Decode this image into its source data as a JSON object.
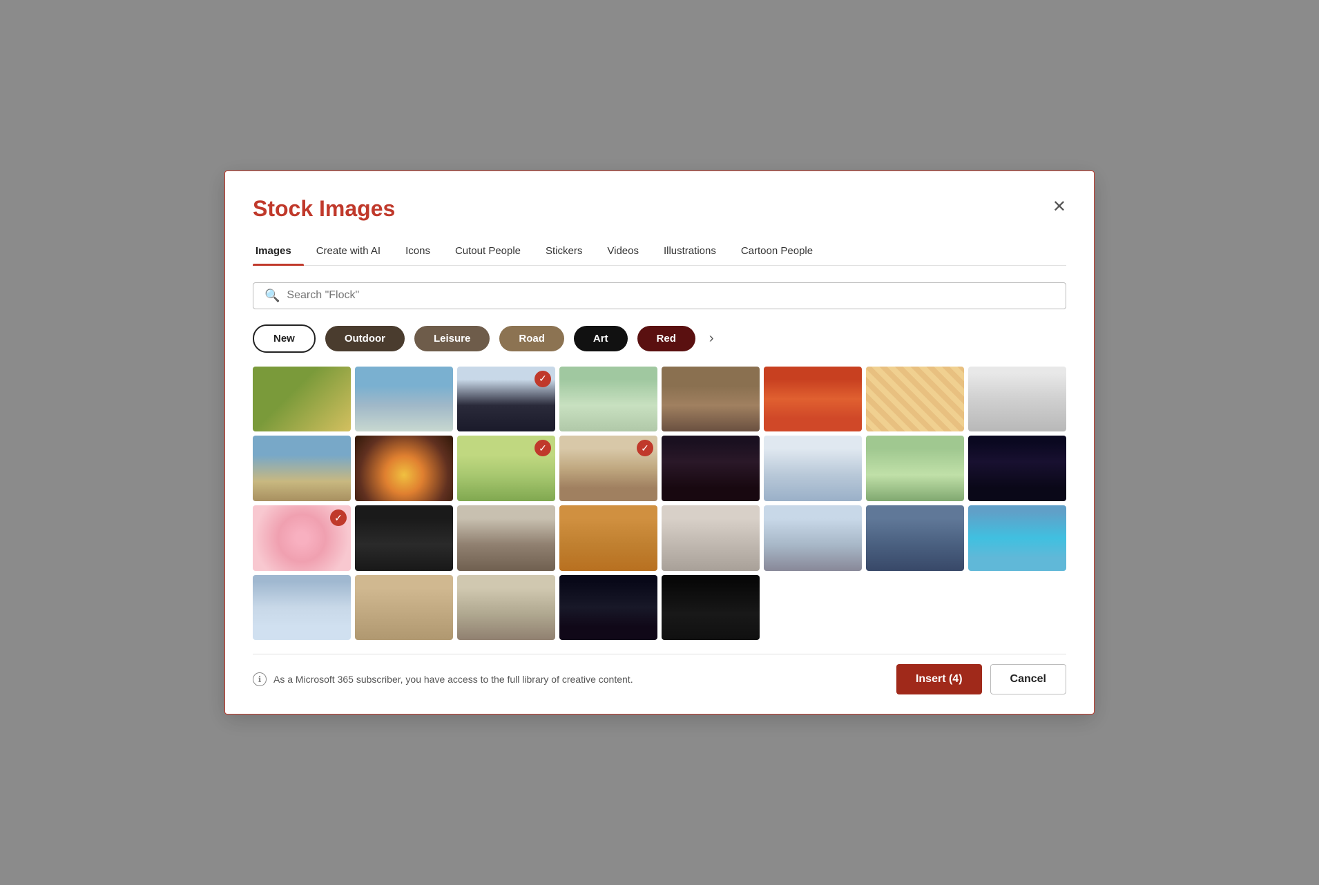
{
  "modal": {
    "title": "Stock Images",
    "close_label": "✕"
  },
  "tabs": [
    {
      "id": "images",
      "label": "Images",
      "active": true
    },
    {
      "id": "create-ai",
      "label": "Create with AI",
      "active": false
    },
    {
      "id": "icons",
      "label": "Icons",
      "active": false
    },
    {
      "id": "cutout-people",
      "label": "Cutout People",
      "active": false
    },
    {
      "id": "stickers",
      "label": "Stickers",
      "active": false
    },
    {
      "id": "videos",
      "label": "Videos",
      "active": false
    },
    {
      "id": "illustrations",
      "label": "Illustrations",
      "active": false
    },
    {
      "id": "cartoon-people",
      "label": "Cartoon People",
      "active": false
    }
  ],
  "search": {
    "placeholder": "Search \"Flock\"",
    "value": "Search \"Flock\""
  },
  "filters": [
    {
      "id": "new",
      "label": "New",
      "style": "active"
    },
    {
      "id": "outdoor",
      "label": "Outdoor",
      "style": "dark"
    },
    {
      "id": "leisure",
      "label": "Leisure",
      "style": "medium"
    },
    {
      "id": "road",
      "label": "Road",
      "style": "darker"
    },
    {
      "id": "art",
      "label": "Art",
      "style": "black"
    },
    {
      "id": "red",
      "label": "Red",
      "style": "darkred"
    }
  ],
  "images": [
    {
      "id": 1,
      "css": "img-cow",
      "checked": false
    },
    {
      "id": 2,
      "css": "img-bridge",
      "checked": false
    },
    {
      "id": 3,
      "css": "img-woman",
      "checked": true
    },
    {
      "id": 4,
      "css": "img-paperpeople",
      "checked": false
    },
    {
      "id": 5,
      "css": "img-bread",
      "checked": false
    },
    {
      "id": 6,
      "css": "img-smoke",
      "checked": false
    },
    {
      "id": 7,
      "css": "img-pattern",
      "checked": false
    },
    {
      "id": 8,
      "css": "img-book",
      "checked": false
    },
    {
      "id": 9,
      "css": "img-beach",
      "checked": false
    },
    {
      "id": 10,
      "css": "img-sunburst",
      "checked": false
    },
    {
      "id": 11,
      "css": "img-cat",
      "checked": true
    },
    {
      "id": 12,
      "css": "img-woman2",
      "checked": true
    },
    {
      "id": 13,
      "css": "img-dancer",
      "checked": false
    },
    {
      "id": 14,
      "css": "img-feet",
      "checked": false
    },
    {
      "id": 15,
      "css": "img-stretch",
      "checked": false
    },
    {
      "id": 16,
      "css": "img-crowd",
      "checked": false
    },
    {
      "id": 17,
      "css": "img-pink",
      "checked": true
    },
    {
      "id": 18,
      "css": "img-hands",
      "checked": false
    },
    {
      "id": 19,
      "css": "img-wedding",
      "checked": false
    },
    {
      "id": 20,
      "css": "img-food",
      "checked": false
    },
    {
      "id": 21,
      "css": "img-haircut",
      "checked": false
    },
    {
      "id": 22,
      "css": "img-monument",
      "checked": false
    },
    {
      "id": 23,
      "css": "img-bird",
      "checked": false
    },
    {
      "id": 24,
      "css": "img-building",
      "checked": false
    },
    {
      "id": 25,
      "css": "img-sky",
      "checked": false
    },
    {
      "id": 26,
      "css": "img-package",
      "checked": false
    },
    {
      "id": 27,
      "css": "img-couple",
      "checked": false
    },
    {
      "id": 28,
      "css": "img-concert",
      "checked": false
    },
    {
      "id": 29,
      "css": "img-dark",
      "checked": false
    }
  ],
  "footer": {
    "note": "As a Microsoft 365 subscriber, you have access to the full library of creative content.",
    "info_icon": "ℹ",
    "insert_label": "Insert (4)",
    "cancel_label": "Cancel"
  }
}
